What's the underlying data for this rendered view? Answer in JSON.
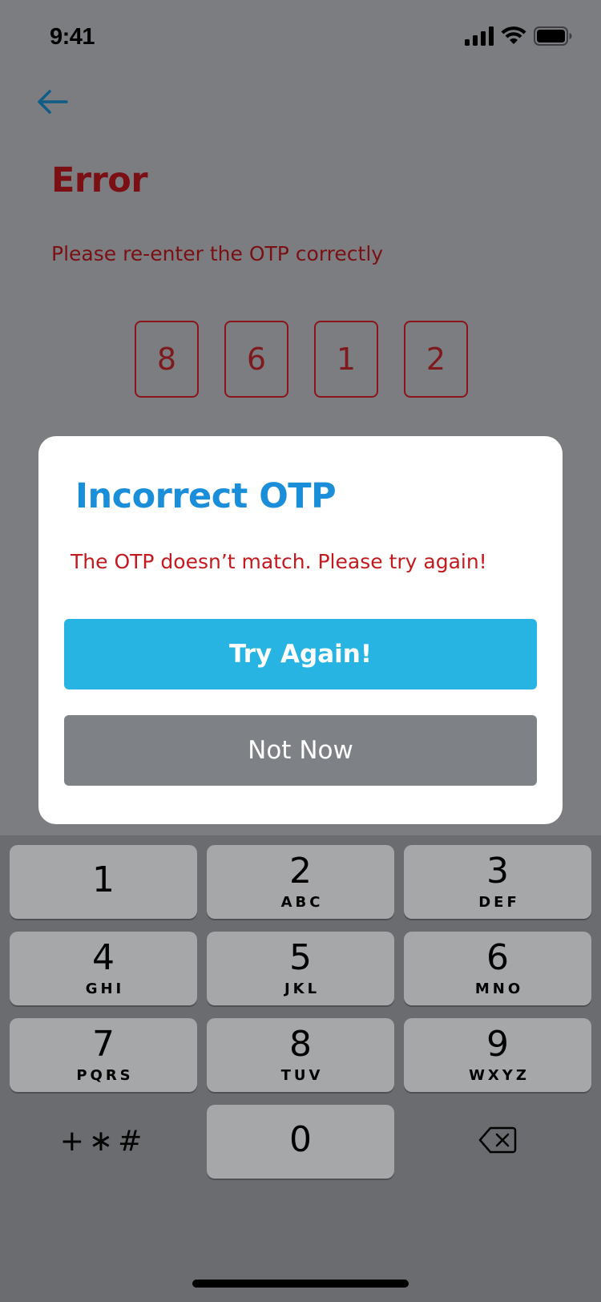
{
  "status_bar": {
    "time": "9:41"
  },
  "header": {
    "title": "Error",
    "subtitle": "Please re-enter the OTP correctly"
  },
  "otp": {
    "digits": [
      "8",
      "6",
      "1",
      "2"
    ]
  },
  "dialog": {
    "title": "Incorrect OTP",
    "message": "The OTP doesn’t match. Please try again!",
    "primary_label": "Try Again!",
    "secondary_label": "Not Now"
  },
  "keypad": {
    "keys": [
      {
        "num": "1",
        "letters": ""
      },
      {
        "num": "2",
        "letters": "ABC"
      },
      {
        "num": "3",
        "letters": "DEF"
      },
      {
        "num": "4",
        "letters": "GHI"
      },
      {
        "num": "5",
        "letters": "JKL"
      },
      {
        "num": "6",
        "letters": "MNO"
      },
      {
        "num": "7",
        "letters": "PQRS"
      },
      {
        "num": "8",
        "letters": "TUV"
      },
      {
        "num": "9",
        "letters": "WXYZ"
      }
    ],
    "symbols": "+∗#",
    "zero": "0"
  },
  "colors": {
    "error_red": "#7a0f14",
    "dialog_title_blue": "#1a8ed8",
    "primary_button": "#27b4e3",
    "secondary_button": "#7e8185",
    "overlay": "#7c7d80"
  }
}
